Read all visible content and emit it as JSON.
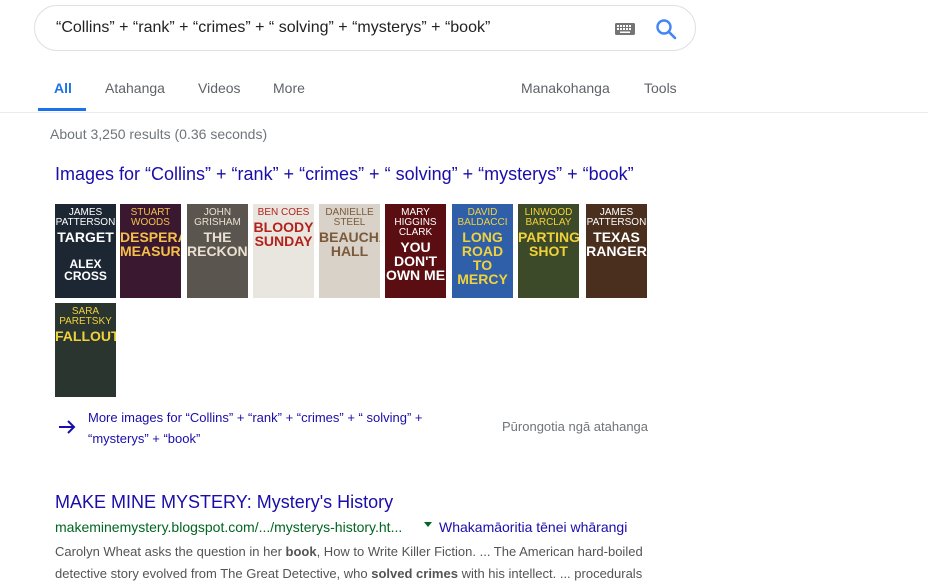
{
  "search": {
    "query": "“Collins” + “rank” + “crimes” + “ solving” + “mysterys” + “book”"
  },
  "tabs": [
    {
      "label": "All"
    },
    {
      "label": "Atahanga"
    },
    {
      "label": "Videos"
    },
    {
      "label": "More"
    },
    {
      "label": "Manakohanga"
    },
    {
      "label": "Tools"
    }
  ],
  "stats": "About 3,250 results (0.36 seconds)",
  "images_section": {
    "heading": "Images for “Collins” + “rank” + “crimes” + “ solving” + “mysterys” + “book”",
    "thumbnails": [
      {
        "line1": "JAMES PATTERSON",
        "line2": "TARGET",
        "line3": "ALEX CROSS",
        "bg": "#1c2733",
        "fg": "#ffffff"
      },
      {
        "line1": "STUART WOODS",
        "line2": "DESPERATE MEASURES",
        "line3": "",
        "bg": "#3a1830",
        "fg": "#f5c04a"
      },
      {
        "line1": "JOHN GRISHAM",
        "line2": "THE RECKONING",
        "line3": "",
        "bg": "#5b5550",
        "fg": "#e8e0d0"
      },
      {
        "line1": "BEN COES",
        "line2": "BLOODY SUNDAY",
        "line3": "",
        "bg": "#e9e6e0",
        "fg": "#b3221c"
      },
      {
        "line1": "DANIELLE STEEL",
        "line2": "BEAUCHAMP HALL",
        "line3": "",
        "bg": "#d9d2c8",
        "fg": "#7a5a3a"
      },
      {
        "line1": "MARY HIGGINS CLARK",
        "line2": "YOU DON'T OWN ME",
        "line3": "",
        "bg": "#5a0e12",
        "fg": "#ffffff"
      },
      {
        "line1": "DAVID BALDACCI",
        "line2": "LONG ROAD TO MERCY",
        "line3": "",
        "bg": "#2e5fa8",
        "fg": "#f2d23a"
      },
      {
        "line1": "LINWOOD BARCLAY",
        "line2": "PARTING SHOT",
        "line3": "",
        "bg": "#3c4a2a",
        "fg": "#f2d23a"
      },
      {
        "line1": "JAMES PATTERSON",
        "line2": "TEXAS RANGER",
        "line3": "",
        "bg": "#4a2e1e",
        "fg": "#ffffff"
      },
      {
        "line1": "SARA PARETSKY",
        "line2": "FALLOUT",
        "line3": "",
        "bg": "#2a3530",
        "fg": "#f2d23a"
      }
    ],
    "more_link": "More images for “Collins” + “rank” + “crimes” + “ solving” + “mysterys” + “book”",
    "report_link": "Pūrongotia ngā atahanga"
  },
  "result": {
    "title": "MAKE MINE MYSTERY: Mystery's History",
    "url": "makeminemystery.blogspot.com/.../mysterys-history.ht...",
    "translate_label": "Whakamāoritia tēnei whārangi",
    "snippet_parts": [
      {
        "text": "Carolyn Wheat asks the question in her ",
        "bold": false
      },
      {
        "text": "book",
        "bold": true
      },
      {
        "text": ", How to Write Killer Fiction. ... The American hard-boiled detective story evolved from The Great Detective, who ",
        "bold": false
      },
      {
        "text": "solved crimes",
        "bold": true
      },
      {
        "text": " with his intellect. ... procedurals",
        "bold": false
      }
    ]
  },
  "colors": {
    "link": "#1a0dab",
    "url_green": "#006621",
    "accent_blue": "#1a73e8"
  }
}
